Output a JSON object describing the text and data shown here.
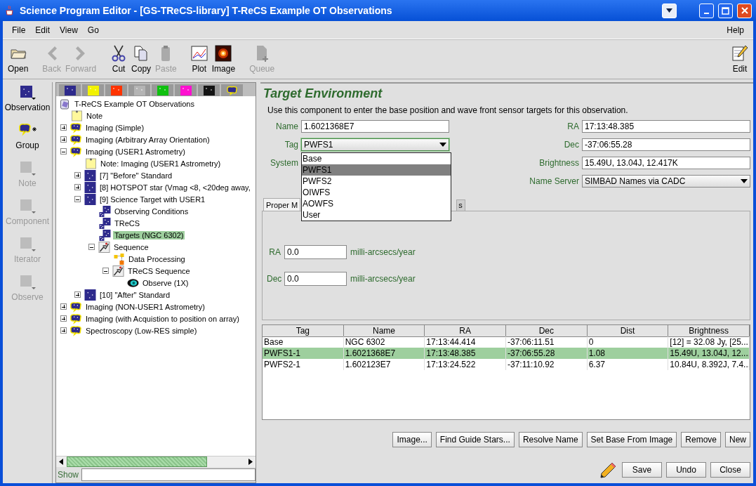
{
  "window": {
    "title": "Science Program Editor - [GS-TReCS-library] T-ReCS Example OT Observations"
  },
  "menu": {
    "items": [
      "File",
      "Edit",
      "View",
      "Go"
    ],
    "right": "Help"
  },
  "toolbar": {
    "groups": [
      [
        {
          "label": "Open",
          "kind": "open",
          "disabled": false
        }
      ],
      [
        {
          "label": "Back",
          "kind": "back",
          "disabled": true
        },
        {
          "label": "Forward",
          "kind": "forward",
          "disabled": true
        }
      ],
      [
        {
          "label": "Cut",
          "kind": "cut",
          "disabled": false
        },
        {
          "label": "Copy",
          "kind": "copy",
          "disabled": false
        },
        {
          "label": "Paste",
          "kind": "paste",
          "disabled": true
        }
      ],
      [
        {
          "label": "Plot",
          "kind": "plot",
          "disabled": false
        },
        {
          "label": "Image",
          "kind": "image",
          "disabled": false
        }
      ],
      [
        {
          "label": "Queue",
          "kind": "queue",
          "disabled": true
        }
      ]
    ],
    "right": {
      "label": "Edit",
      "kind": "edit",
      "disabled": false
    }
  },
  "palette": [
    {
      "label": "Observation",
      "kind": "observation",
      "disabled": false
    },
    {
      "label": "Group",
      "kind": "group",
      "disabled": false
    },
    {
      "label": "Note",
      "kind": "note",
      "disabled": true
    },
    {
      "label": "Component",
      "kind": "component",
      "disabled": true
    },
    {
      "label": "Iterator",
      "kind": "iterator",
      "disabled": true
    },
    {
      "label": "Observe",
      "kind": "observe",
      "disabled": true
    }
  ],
  "color_tabs": [
    {
      "kind": "swatch",
      "color": "#2e2a8c"
    },
    {
      "kind": "swatch",
      "color": "#f2f200"
    },
    {
      "kind": "swatch",
      "color": "#ff3300"
    },
    {
      "kind": "swatch",
      "color": "#b4b4b4"
    },
    {
      "kind": "swatch",
      "color": "#10c010"
    },
    {
      "kind": "swatch",
      "color": "#ff10d0"
    },
    {
      "kind": "swatch",
      "color": "#141414"
    },
    {
      "kind": "group"
    }
  ],
  "tree": {
    "label": "T-ReCS Example OT Observations",
    "kind": "program",
    "selected": false,
    "children": [
      {
        "label": "Note",
        "kind": "note",
        "selected": false
      },
      {
        "label": "Imaging (Simple)",
        "kind": "group",
        "expanded": false,
        "selected": false
      },
      {
        "label": "Imaging (Arbitrary Array Orientation)",
        "kind": "group",
        "expanded": false,
        "selected": false
      },
      {
        "label": "Imaging (USER1 Astrometry)",
        "kind": "group",
        "expanded": true,
        "selected": false,
        "children": [
          {
            "label": "Note: Imaging (USER1 Astrometry)",
            "kind": "note",
            "selected": false
          },
          {
            "label": "[7] \"Before\" Standard",
            "kind": "observation",
            "expanded": false,
            "selected": false
          },
          {
            "label": "[8] HOTSPOT star (Vmag <8, <20deg away,",
            "kind": "observation",
            "expanded": false,
            "selected": false
          },
          {
            "label": "[9] Science Target with USER1",
            "kind": "observation",
            "expanded": true,
            "selected": false,
            "children": [
              {
                "label": "Observing Conditions",
                "kind": "component",
                "selected": false
              },
              {
                "label": "TReCS",
                "kind": "component",
                "selected": false
              },
              {
                "label": "Targets (NGC 6302)",
                "kind": "component",
                "selected": true
              },
              {
                "label": "Sequence",
                "kind": "sequence",
                "expanded": true,
                "selected": false,
                "children": [
                  {
                    "label": "Data Processing",
                    "kind": "dataproc",
                    "selected": false
                  },
                  {
                    "label": "TReCS Sequence",
                    "kind": "sequence",
                    "expanded": true,
                    "selected": false,
                    "children": [
                      {
                        "label": "Observe (1X)",
                        "kind": "observe",
                        "selected": false
                      }
                    ]
                  }
                ]
              }
            ]
          },
          {
            "label": "[10] \"After\" Standard",
            "kind": "observation",
            "expanded": false,
            "selected": false
          }
        ]
      },
      {
        "label": "Imaging (NON-USER1 Astrometry)",
        "kind": "group",
        "expanded": false,
        "selected": false
      },
      {
        "label": "Imaging (with Acquistion to position on array)",
        "kind": "group",
        "expanded": false,
        "selected": false
      },
      {
        "label": "Spectroscopy (Low-RES simple)",
        "kind": "group",
        "expanded": false,
        "selected": false
      }
    ]
  },
  "show_field": {
    "label": "Show"
  },
  "editor": {
    "title": "Target Environment",
    "description": "Use this component to enter the base position and wave front sensor targets for this observation.",
    "left_fields": [
      {
        "label": "Name",
        "kind": "text",
        "value": "1.6021368E7"
      },
      {
        "label": "Tag",
        "kind": "combo",
        "value": "PWFS1",
        "expanded": true,
        "options": [
          {
            "label": "Base",
            "selected": false
          },
          {
            "label": "PWFS1",
            "selected": true
          },
          {
            "label": "PWFS2",
            "selected": false
          },
          {
            "label": "OIWFS",
            "selected": false
          },
          {
            "label": "AOWFS",
            "selected": false
          },
          {
            "label": "User",
            "selected": false
          }
        ]
      },
      {
        "label": "System",
        "kind": "covered"
      }
    ],
    "right_fields": [
      {
        "label": "RA",
        "kind": "text",
        "value": "17:13:48.385"
      },
      {
        "label": "Dec",
        "kind": "text",
        "value": "-37:06:55.28"
      },
      {
        "label": "Brightness",
        "kind": "text",
        "value": "15.49U, 13.04J, 12.417K"
      },
      {
        "label": "Name Server",
        "kind": "combo",
        "value": "SIMBAD Names via CADC",
        "expanded": false
      }
    ],
    "tabs": [
      {
        "label": "Proper M",
        "selected": true
      },
      {
        "label": "s",
        "selected": false
      }
    ],
    "proper_motion": [
      {
        "label": "RA",
        "value": "0.0",
        "unit": "milli-arcsecs/year"
      },
      {
        "label": "Dec",
        "value": "0.0",
        "unit": "milli-arcsecs/year"
      }
    ],
    "table": {
      "columns": [
        "Tag",
        "Name",
        "RA",
        "Dec",
        "Dist",
        "Brightness"
      ],
      "rows": [
        {
          "selected": false,
          "cells": [
            "Base",
            "NGC 6302",
            "17:13:44.414",
            "-37:06:11.51",
            "0",
            "[12] = 32.08 Jy, [25..."
          ]
        },
        {
          "selected": true,
          "cells": [
            "PWFS1-1",
            "1.6021368E7",
            "17:13:48.385",
            "-37:06:55.28",
            "1.08",
            "15.49U, 13.04J, 12...."
          ]
        },
        {
          "selected": false,
          "cells": [
            "PWFS2-1",
            "1.602123E7",
            "17:13:24.522",
            "-37:11:10.92",
            "6.37",
            "10.84U, 8.392J, 7.4..."
          ]
        }
      ]
    },
    "buttons": [
      "Image...",
      "Find Guide Stars...",
      "Resolve Name",
      "Set Base From Image",
      "Remove",
      "New"
    ],
    "footer_buttons": [
      "Save",
      "Undo",
      "Close"
    ]
  }
}
